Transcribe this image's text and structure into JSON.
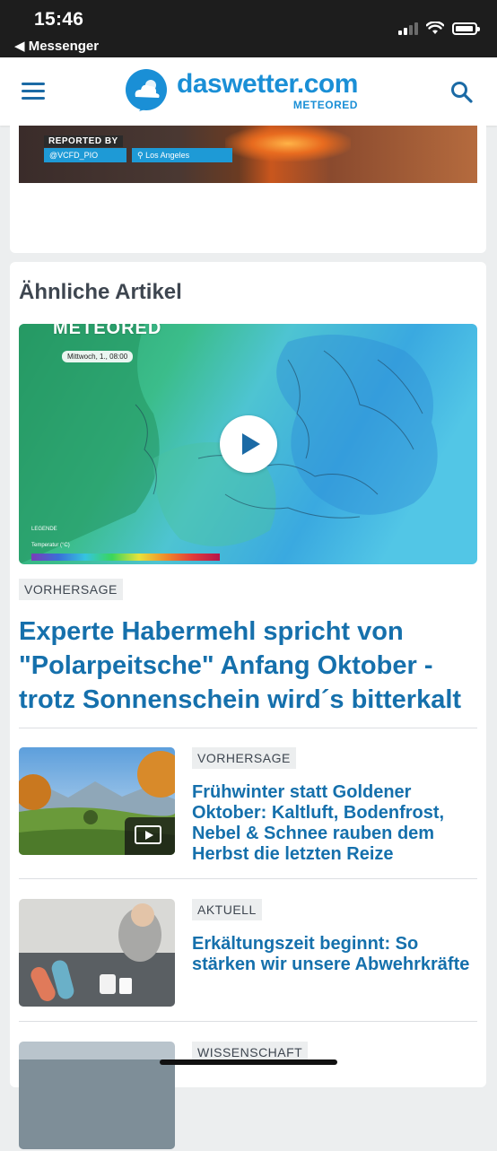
{
  "status_bar": {
    "time": "15:46",
    "back_app": "◀ Messenger"
  },
  "header": {
    "logo_main": "daswetter.com",
    "logo_sub": "METEORED",
    "menu_icon": "hamburger-menu-icon",
    "search_icon": "search-icon",
    "brand_color": "#1a8fd6"
  },
  "video_card": {
    "reported_label": "REPORTED BY",
    "handle": "@VCFD_PIO",
    "location": "Los Angeles"
  },
  "related": {
    "heading": "Ähnliche Artikel",
    "lead": {
      "brand": "METEORED",
      "map_date": "Mittwoch, 1., 08:00",
      "legend_label": "LEGENDE",
      "scale_label": "Temperatur (°C)",
      "category": "VORHERSAGE",
      "title": "Experte Habermehl spricht von \"Polarpeitsche\" Anfang Oktober - trotz Sonnenschein wird´s bitterkalt"
    },
    "items": [
      {
        "category": "VORHERSAGE",
        "title": "Frühwinter statt Goldener Oktober: Kaltluft, Bodenfrost, Nebel & Schnee rauben dem Herbst die letzten Reize",
        "has_video": true
      },
      {
        "category": "AKTUELL",
        "title": "Erkältungszeit beginnt: So stärken wir unsere Abwehrkräfte",
        "has_video": false
      },
      {
        "category": "WISSENSCHAFT",
        "title": "",
        "has_video": false
      }
    ]
  },
  "colors": {
    "title_blue": "#1570ac",
    "badge_bg": "#eceeef",
    "page_bg": "#eceeef"
  }
}
